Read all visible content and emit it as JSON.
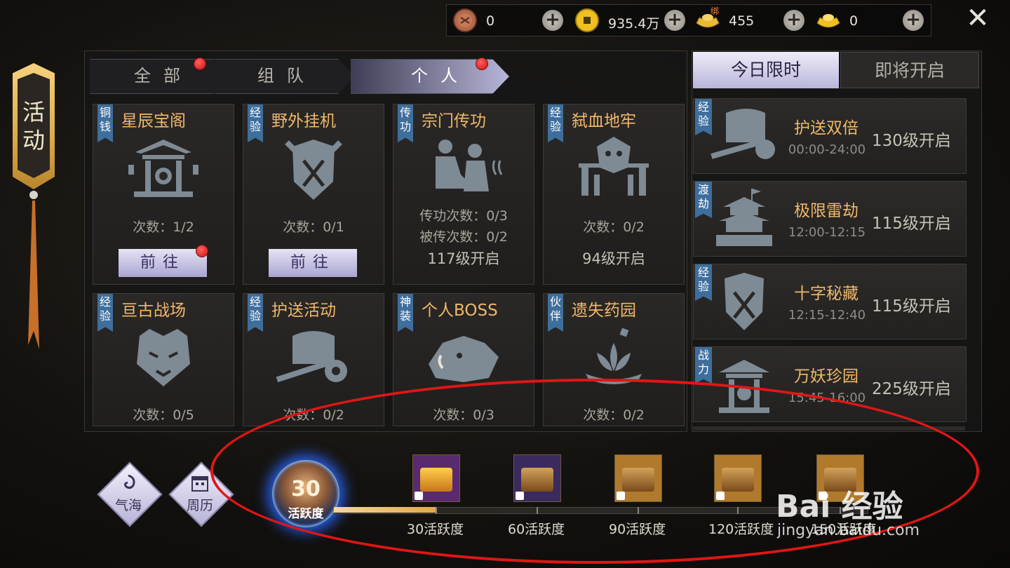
{
  "currency": [
    {
      "icon": "copper-coin-icon",
      "value": "0"
    },
    {
      "icon": "gold-coin-icon",
      "value": "935.4万"
    },
    {
      "icon": "bound-ingot-icon",
      "badge": "绑",
      "value": "455"
    },
    {
      "icon": "gold-ingot-icon",
      "value": "0"
    }
  ],
  "close_icon": "✕",
  "banner": {
    "title": "活动"
  },
  "tabs": [
    {
      "label": "全部",
      "dot": true,
      "active": false
    },
    {
      "label": "组队",
      "dot": false,
      "active": false
    },
    {
      "label": "个人",
      "dot": true,
      "active": true
    }
  ],
  "cards": [
    {
      "tag": "铜钱",
      "title": "星辰宝阁",
      "icon": "pavilion-icon",
      "line1": "次数：1/2",
      "button": "前往",
      "dot": true
    },
    {
      "tag": "经验",
      "title": "野外挂机",
      "icon": "crossed-swords-shield-icon",
      "line1": "次数：0/1",
      "button": "前往",
      "dot": false
    },
    {
      "tag": "传功",
      "title": "宗门传功",
      "icon": "meditation-icon",
      "line1": "传功次数：0/3",
      "line2": "被传次数：0/2",
      "level": "117级开启"
    },
    {
      "tag": "经验",
      "title": "弑血地牢",
      "icon": "demon-gate-icon",
      "line1": "次数：0/2",
      "level": "94级开启"
    },
    {
      "tag": "经验",
      "title": "亘古战场",
      "icon": "tiger-mask-icon",
      "line1": "次数：0/5"
    },
    {
      "tag": "经验",
      "title": "护送活动",
      "icon": "cart-icon",
      "line1": "次数：0/2"
    },
    {
      "tag": "神装",
      "title": "个人BOSS",
      "icon": "boar-icon",
      "line1": "次数：0/3"
    },
    {
      "tag": "伙伴",
      "title": "遗失药园",
      "icon": "lotus-icon",
      "line1": "次数：0/2"
    }
  ],
  "right": {
    "tabs": [
      {
        "label": "今日限时",
        "active": true
      },
      {
        "label": "即将开启",
        "active": false
      }
    ],
    "items": [
      {
        "tag": "经验",
        "icon": "cart-icon",
        "name": "护送双倍",
        "time": "00:00-24:00",
        "level": "130级开启"
      },
      {
        "tag": "渡劫",
        "icon": "pagoda-icon",
        "name": "极限雷劫",
        "time": "12:00-12:15",
        "level": "115级开启"
      },
      {
        "tag": "经验",
        "icon": "crossed-swords-shield-icon",
        "name": "十字秘藏",
        "time": "12:15-12:40",
        "level": "115级开启"
      },
      {
        "tag": "战力",
        "icon": "pavilion-icon",
        "name": "万妖珍园",
        "time": "15:45-16:00",
        "level": "225级开启"
      }
    ]
  },
  "bottom": {
    "buttons": [
      {
        "label": "气海",
        "icon": "vortex-icon"
      },
      {
        "label": "周历",
        "icon": "calendar-icon"
      }
    ],
    "activity": {
      "value": "30",
      "label": "活跃度"
    },
    "progress": 0.0,
    "milestones": [
      {
        "label": "30活跃度",
        "color": "#5a2a6e",
        "reached": true
      },
      {
        "label": "60活跃度",
        "color": "#3a2a5e",
        "reached": false
      },
      {
        "label": "90活跃度",
        "color": "#b0792c",
        "reached": false
      },
      {
        "label": "120活跃度",
        "color": "#b0792c",
        "reached": false
      },
      {
        "label": "150活跃度",
        "color": "#b0792c",
        "reached": false
      }
    ]
  },
  "watermark": {
    "logo": "Bai 经验",
    "url": "jingyan.baidu.com"
  },
  "colors": {
    "accent": "#f0b76a",
    "tag_blue": "#3e6e9c",
    "highlight": "#e01616"
  }
}
